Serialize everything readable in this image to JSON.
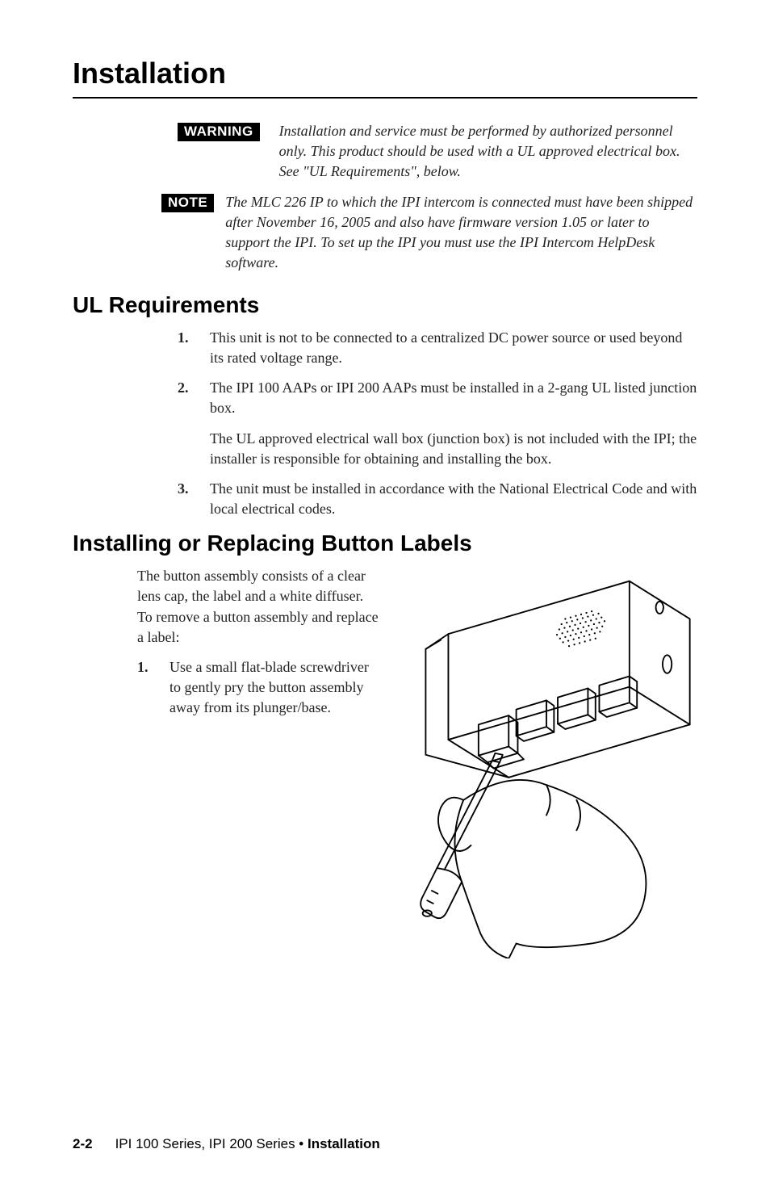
{
  "page_title": "Installation",
  "warning": {
    "badge": "WARNING",
    "text": "Installation and service must be performed by authorized personnel only.  This product should be used with a UL approved electrical box.  See \"UL Requirements\", below."
  },
  "note": {
    "badge": "NOTE",
    "text": "The MLC 226 IP to which the IPI intercom is connected must have been shipped after November 16, 2005 and also have firmware version 1.05 or later to support the IPI.  To set up the IPI you must use the IPI Intercom HelpDesk software."
  },
  "ul_req": {
    "heading": "UL Requirements",
    "items": [
      {
        "num": "1.",
        "text": "This unit is not to be connected to a centralized DC power source or used beyond its rated voltage range."
      },
      {
        "num": "2.",
        "text": "The IPI 100 AAPs or IPI 200 AAPs must be installed in a 2-gang UL listed junction box."
      },
      {
        "sub": "The UL approved electrical wall box (junction box) is not included with the IPI; the installer is responsible for obtaining and installing the box."
      },
      {
        "num": "3.",
        "text": "The unit must be installed in accordance with the National Electrical Code and with local electrical codes."
      }
    ]
  },
  "install_labels": {
    "heading": "Installing or Replacing Button Labels",
    "intro": "The button assembly consists of a clear lens cap, the label and a white diffuser.  To remove a button assembly and replace a label:",
    "step1_num": "1.",
    "step1_text": "Use a small flat-blade screwdriver to gently pry the button assembly away from its plunger/base."
  },
  "footer": {
    "page_num": "2-2",
    "text_a": "IPI 100 Series, IPI 200 Series • ",
    "text_b": "Installation"
  }
}
